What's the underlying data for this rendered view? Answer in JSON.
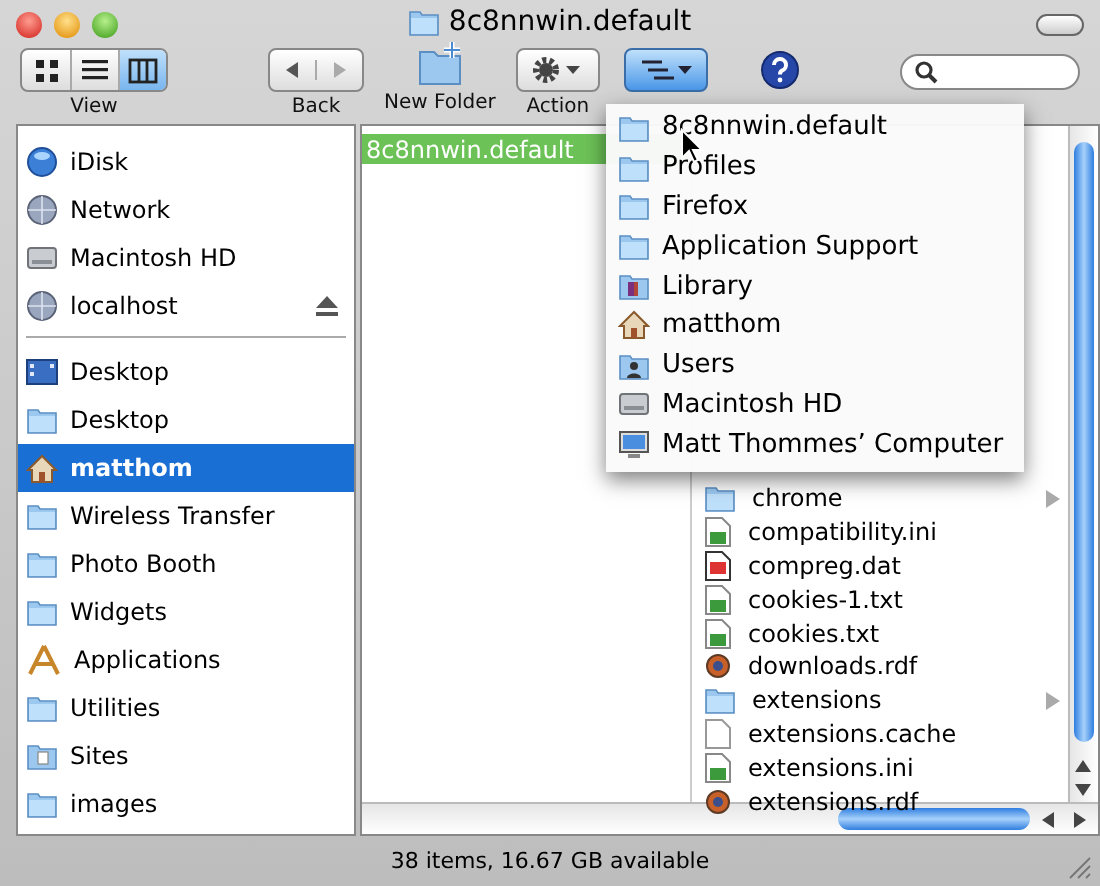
{
  "window": {
    "title": "8c8nnwin.default"
  },
  "toolbar": {
    "view": {
      "label": "View",
      "modes": [
        {
          "kind": "icons",
          "selected": false
        },
        {
          "kind": "list",
          "selected": false
        },
        {
          "kind": "columns",
          "selected": true
        }
      ]
    },
    "back": {
      "label": "Back"
    },
    "new_folder": {
      "label": "New Folder"
    },
    "action": {
      "label": "Action"
    },
    "path_button": {
      "pressed": true
    }
  },
  "sidebar": {
    "devices": [
      {
        "name": "iDisk",
        "kind": "idisk",
        "selected": false,
        "ejectable": false
      },
      {
        "name": "Network",
        "kind": "network",
        "selected": false,
        "ejectable": false
      },
      {
        "name": "Macintosh HD",
        "kind": "disk",
        "selected": false,
        "ejectable": false
      },
      {
        "name": "localhost",
        "kind": "server",
        "selected": false,
        "ejectable": true
      }
    ],
    "places": [
      {
        "name": "Desktop",
        "kind": "desktop",
        "selected": false,
        "ejectable": false
      },
      {
        "name": "Desktop",
        "kind": "folder",
        "selected": false,
        "ejectable": false
      },
      {
        "name": "matthom",
        "kind": "home",
        "selected": true,
        "ejectable": false
      },
      {
        "name": "Wireless Transfer",
        "kind": "folder",
        "selected": false,
        "ejectable": false
      },
      {
        "name": "Photo Booth",
        "kind": "folder",
        "selected": false,
        "ejectable": false
      },
      {
        "name": "Widgets",
        "kind": "folder",
        "selected": false,
        "ejectable": false
      },
      {
        "name": "Applications",
        "kind": "apps",
        "selected": false,
        "ejectable": false
      },
      {
        "name": "Utilities",
        "kind": "folder",
        "selected": false,
        "ejectable": false
      },
      {
        "name": "Sites",
        "kind": "sites",
        "selected": false,
        "ejectable": false
      },
      {
        "name": "images",
        "kind": "folder",
        "selected": false,
        "ejectable": false
      }
    ]
  },
  "column_1": [
    {
      "name": "8c8nnwin.default",
      "selected": true
    }
  ],
  "column_2": [
    {
      "name": "chrome",
      "kind": "folder",
      "expandable": true
    },
    {
      "name": "compatibility.ini",
      "kind": "text",
      "expandable": false
    },
    {
      "name": "compreg.dat",
      "kind": "dat",
      "expandable": false
    },
    {
      "name": "cookies-1.txt",
      "kind": "text",
      "expandable": false
    },
    {
      "name": "cookies.txt",
      "kind": "text",
      "expandable": false
    },
    {
      "name": "downloads.rdf",
      "kind": "rdf",
      "expandable": false
    },
    {
      "name": "extensions",
      "kind": "folder",
      "expandable": true
    },
    {
      "name": "extensions.cache",
      "kind": "blank",
      "expandable": false
    },
    {
      "name": "extensions.ini",
      "kind": "text",
      "expandable": false
    },
    {
      "name": "extensions.rdf",
      "kind": "rdf",
      "expandable": false
    }
  ],
  "path_menu": [
    {
      "name": "8c8nnwin.default",
      "kind": "folder"
    },
    {
      "name": "Profiles",
      "kind": "folder"
    },
    {
      "name": "Firefox",
      "kind": "folder"
    },
    {
      "name": "Application Support",
      "kind": "folder"
    },
    {
      "name": "Library",
      "kind": "library"
    },
    {
      "name": "matthom",
      "kind": "home"
    },
    {
      "name": "Users",
      "kind": "users"
    },
    {
      "name": "Macintosh HD",
      "kind": "disk"
    },
    {
      "name": "Matt Thommes’ Computer",
      "kind": "computer"
    }
  ],
  "status_bar": "38 items, 16.67 GB available"
}
